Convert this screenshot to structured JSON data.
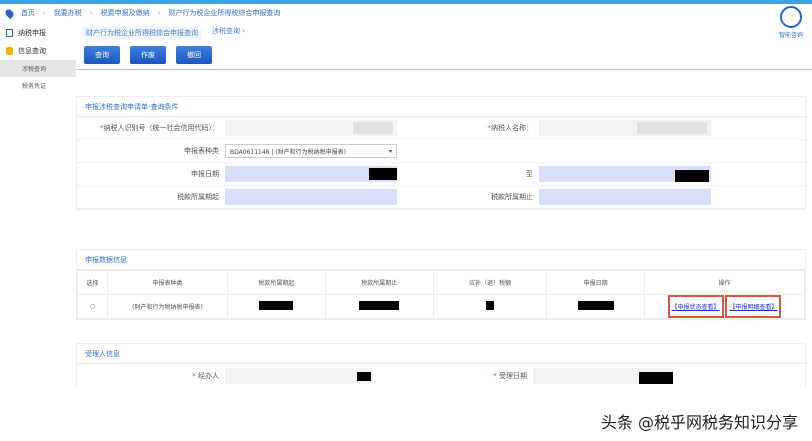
{
  "breadcrumb": [
    "首页",
    "我要办税",
    "税费申报及缴纳",
    "财产行为税企业所得税综合申报查询"
  ],
  "sidebar": {
    "items": [
      {
        "label": "纳税申报"
      },
      {
        "label": "信息查询"
      }
    ],
    "subitems": [
      {
        "label": "涉税查询",
        "active": true
      },
      {
        "label": "税务凭证"
      }
    ]
  },
  "tabs": [
    "财产行为税企业所得税综合申报查询",
    "涉税查询 ›"
  ],
  "toolbar": {
    "query": "查询",
    "void": "作废",
    "withdraw": "撤回"
  },
  "help": "智能咨询",
  "query_section": {
    "title": "申报涉税查询申请单-查询条件",
    "taxpayer_id_label": "纳税人识别号（统一社会信用代码）：",
    "taxpayer_name_label": "纳税人名称：",
    "form_type_label": "申报表种类",
    "form_type_value": "BDA0611148 | (财产和行为税纳税申报表)",
    "date_label": "申报日期",
    "to_label": "至",
    "period_start_label": "税款所属期起",
    "period_end_label": "税款所属期止"
  },
  "data_section": {
    "title": "申报数据信息",
    "columns": [
      "选择",
      "申报表种类",
      "税款所属期起",
      "税款所属期止",
      "应补（退）税额",
      "申报日期",
      "操作"
    ],
    "rows": [
      {
        "form": "(财产和行为税纳税申报表)",
        "actions": [
          "【申报状态查看】",
          "【申报明细查看】"
        ]
      }
    ]
  },
  "handler_section": {
    "title": "受理人信息",
    "handler_label": "经办人",
    "date_label": "受理日期"
  },
  "watermark": "头条 @税乎网税务知识分享",
  "colors": {
    "accent": "#1c56c0",
    "highlight": "#d9573f",
    "input_blue": "#d6e0fb"
  }
}
